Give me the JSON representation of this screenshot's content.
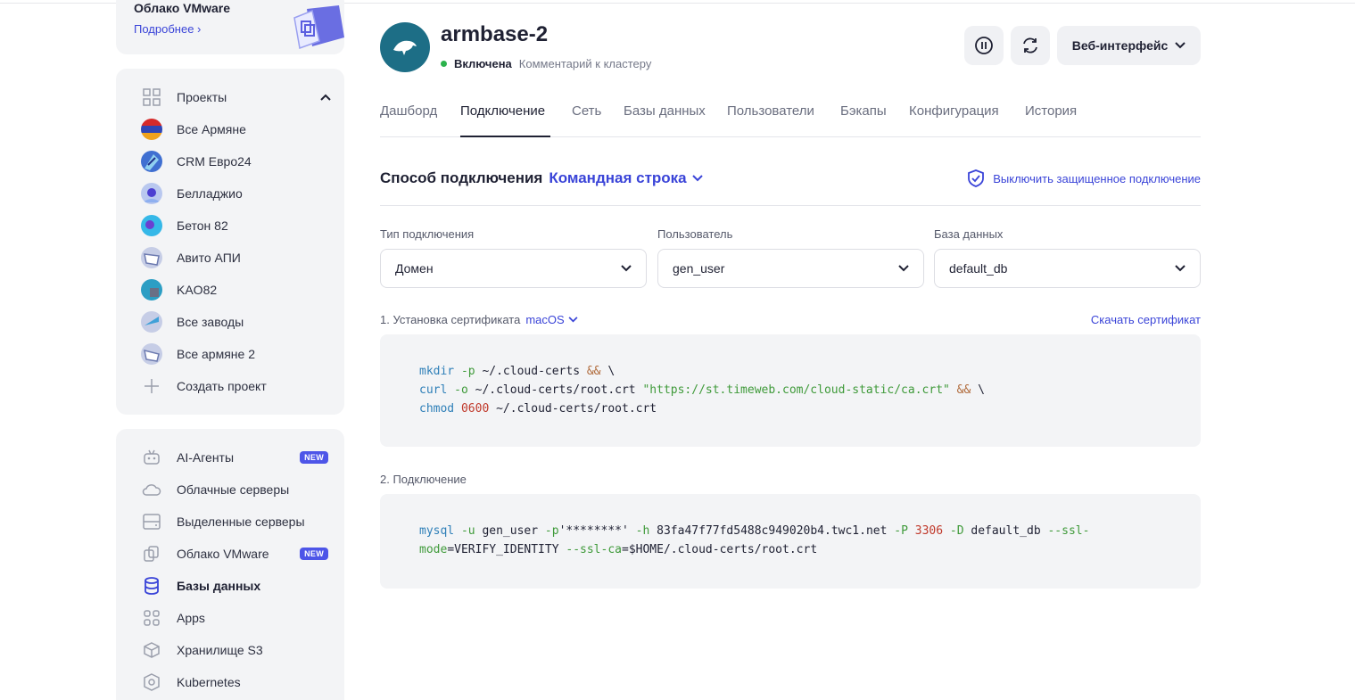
{
  "promo": {
    "title": "Облако VMware",
    "link": "Подробнее"
  },
  "sidebar": {
    "projects_label": "Проекты",
    "projects": [
      {
        "label": "Все Армяне",
        "icon": "armenia-flag-avatar"
      },
      {
        "label": "CRM Евро24",
        "icon": "project-avatar"
      },
      {
        "label": "Белладжио",
        "icon": "project-avatar"
      },
      {
        "label": "Бетон 82",
        "icon": "project-avatar"
      },
      {
        "label": "Авито АПИ",
        "icon": "project-avatar"
      },
      {
        "label": "KAO82",
        "icon": "project-avatar"
      },
      {
        "label": "Все заводы",
        "icon": "project-avatar"
      },
      {
        "label": "Все армяне 2",
        "icon": "project-avatar"
      }
    ],
    "create_project": "Создать проект",
    "services": [
      {
        "label": "AI-Агенты",
        "icon": "robot-icon",
        "badge": "NEW"
      },
      {
        "label": "Облачные серверы",
        "icon": "cloud-icon"
      },
      {
        "label": "Выделенные серверы",
        "icon": "server-icon"
      },
      {
        "label": "Облако VMware",
        "icon": "vmware-icon",
        "badge": "NEW"
      },
      {
        "label": "Базы данных",
        "icon": "database-icon",
        "active": true
      },
      {
        "label": "Apps",
        "icon": "apps-icon"
      },
      {
        "label": "Хранилище S3",
        "icon": "storage-icon"
      },
      {
        "label": "Kubernetes",
        "icon": "kubernetes-icon"
      }
    ]
  },
  "header": {
    "cluster_name": "armbase-2",
    "status": "Включена",
    "comment": "Комментарий к кластеру",
    "web_button": "Веб-интерфейс"
  },
  "tabs": [
    "Дашборд",
    "Подключение",
    "Сеть",
    "Базы данных",
    "Пользователи",
    "Бэкапы",
    "Конфигурация",
    "История"
  ],
  "active_tab": "Подключение",
  "connection": {
    "title": "Способ подключения",
    "method": "Командная строка",
    "secure_toggle": "Выключить защищенное подключение",
    "fields": {
      "type_label": "Тип подключения",
      "type_value": "Домен",
      "user_label": "Пользователь",
      "user_value": "gen_user",
      "db_label": "База данных",
      "db_value": "default_db"
    },
    "step1": "1. Установка сертификата",
    "step1_os": "macOS",
    "download_cert": "Скачать сертификат",
    "step2": "2. Подключение"
  },
  "code1": {
    "l1_cmd": "mkdir",
    "l1_flag": "-p",
    "l1_arg": "~/.cloud-certs",
    "l1_op": "&&",
    "l1_tail": "\\",
    "l2_cmd": "curl",
    "l2_flag": "-o",
    "l2_arg": "~/.cloud-certs/root.crt",
    "l2_str": "\"https://st.timeweb.com/cloud-static/ca.crt\"",
    "l2_op": "&&",
    "l2_tail": "\\",
    "l3_cmd": "chmod",
    "l3_num": "0600",
    "l3_arg": "~/.cloud-certs/root.crt"
  },
  "code2": {
    "cmd": "mysql",
    "u_flag": "-u",
    "user": "gen_user",
    "p_flag": "-p",
    "password": "'********'",
    "h_flag": "-h",
    "host": "83fa47f77fd5488c949020b4.twc1.net",
    "P_flag": "-P",
    "port": "3306",
    "D_flag": "-D",
    "db": "default_db",
    "ssl_flag_a": "--ssl-",
    "ssl_flag_b": "mode",
    "ssl_mode": "=VERIFY_IDENTITY",
    "ca_flag": "--ssl-ca",
    "ca_path": "=$HOME/.cloud-certs/root.crt"
  }
}
